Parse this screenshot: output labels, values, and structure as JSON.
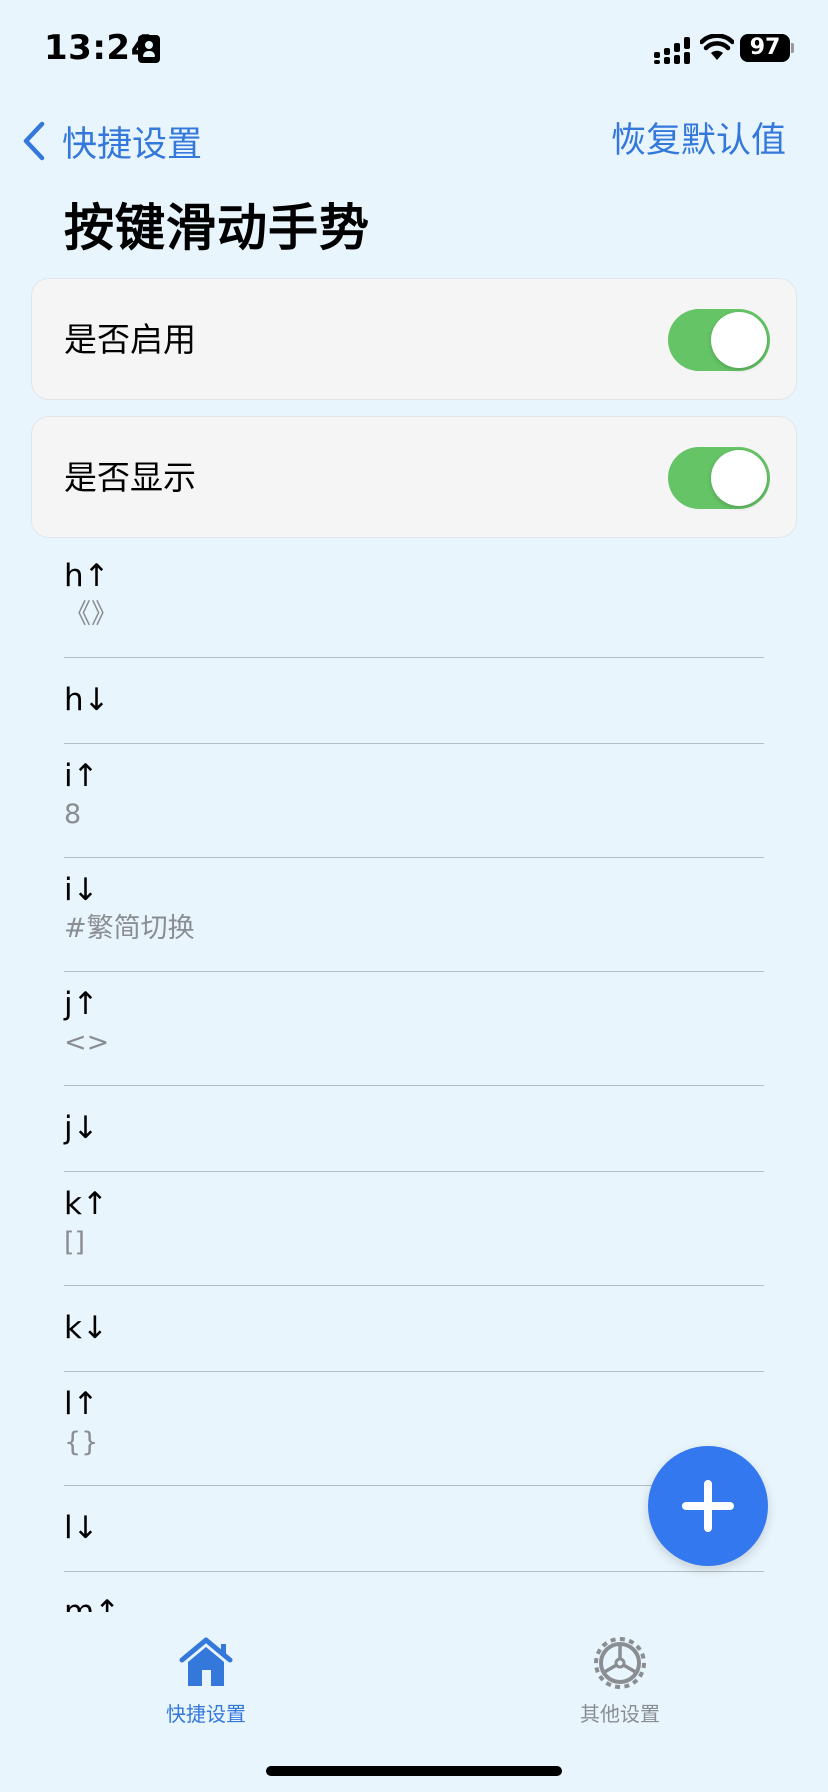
{
  "status_bar": {
    "time": "13:24",
    "battery_level": "97"
  },
  "nav": {
    "back_label": "快捷设置",
    "reset_label": "恢复默认值",
    "title": "按键滑动手势"
  },
  "toggles": [
    {
      "label": "是否启用",
      "on": true
    },
    {
      "label": "是否显示",
      "on": true
    }
  ],
  "gestures": [
    {
      "key": "h↑",
      "value": "《》"
    },
    {
      "key": "h↓",
      "value": ""
    },
    {
      "key": "i↑",
      "value": "8"
    },
    {
      "key": "i↓",
      "value": "#繁简切换"
    },
    {
      "key": "j↑",
      "value": "<>"
    },
    {
      "key": "j↓",
      "value": ""
    },
    {
      "key": "k↑",
      "value": "[]"
    },
    {
      "key": "k↓",
      "value": ""
    },
    {
      "key": "l↑",
      "value": "{}"
    },
    {
      "key": "l↓",
      "value": ""
    },
    {
      "key": "m↑",
      "value": ""
    }
  ],
  "tabs": [
    {
      "label": "快捷设置",
      "icon": "home-icon",
      "active": true
    },
    {
      "label": "其他设置",
      "icon": "gear-icon",
      "active": false
    }
  ],
  "colors": {
    "accent": "#3478db",
    "toggle_on": "#65c466",
    "background": "#e8f5fc",
    "fab": "#3478f0"
  }
}
